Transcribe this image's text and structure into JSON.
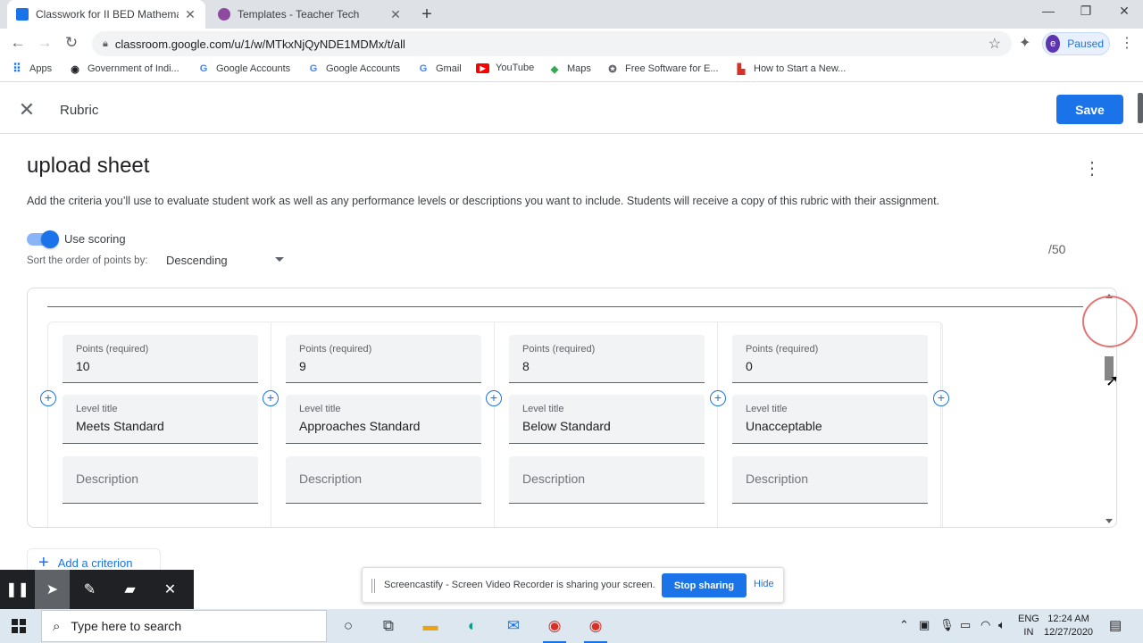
{
  "browser": {
    "tabs": [
      {
        "title": "Classwork for II BED Mathematics",
        "active": true
      },
      {
        "title": "Templates - Teacher Tech",
        "active": false
      }
    ],
    "close_glyph": "✕",
    "newtab_glyph": "+",
    "window_controls": [
      "—",
      "❐",
      "✕"
    ],
    "url": "classroom.google.com/u/1/w/MTkxNjQyNDE1MDMx/t/all",
    "profile_initial": "e",
    "profile_status": "Paused"
  },
  "bookmarks": [
    {
      "label": "Apps",
      "icon": "apps-grid-icon",
      "color": "#1a73e8"
    },
    {
      "label": "Government of Indi...",
      "icon": "emblem-icon",
      "color": "#202124"
    },
    {
      "label": "Google Accounts",
      "icon": "google-icon",
      "color": "#4285f4"
    },
    {
      "label": "Google Accounts",
      "icon": "google-icon",
      "color": "#4285f4"
    },
    {
      "label": "Gmail",
      "icon": "google-icon",
      "color": "#4285f4"
    },
    {
      "label": "YouTube",
      "icon": "youtube-icon",
      "color": "#ff0000"
    },
    {
      "label": "Maps",
      "icon": "maps-icon",
      "color": "#34a853"
    },
    {
      "label": "Free Software for E...",
      "icon": "software-icon",
      "color": "#5f6368"
    },
    {
      "label": "How to Start a New...",
      "icon": "blocks-icon",
      "color": "#d93025"
    }
  ],
  "header": {
    "title": "Rubric",
    "save_label": "Save"
  },
  "rubric": {
    "title": "upload sheet",
    "description": "Add the criteria you’ll use to evaluate student work as well as any performance levels or descriptions you want to include. Students will receive a copy of this rubric with their assignment.",
    "use_scoring_label": "Use scoring",
    "use_scoring": true,
    "sort_label": "Sort the order of points by:",
    "sort_value": "Descending",
    "total": "/50",
    "levels": [
      {
        "points_label": "Points (required)",
        "points": "10",
        "title_label": "Level title",
        "title": "Meets Standard",
        "desc_placeholder": "Description"
      },
      {
        "points_label": "Points (required)",
        "points": "9",
        "title_label": "Level title",
        "title": "Approaches Standard",
        "desc_placeholder": "Description"
      },
      {
        "points_label": "Points (required)",
        "points": "8",
        "title_label": "Level title",
        "title": "Below Standard",
        "desc_placeholder": "Description"
      },
      {
        "points_label": "Points (required)",
        "points": "0",
        "title_label": "Level title",
        "title": "Unacceptable",
        "desc_placeholder": "Description"
      }
    ],
    "add_criterion_label": "Add a criterion"
  },
  "screencastify": {
    "message": "Screencastify - Screen Video Recorder is sharing your screen.",
    "stop_label": "Stop sharing",
    "hide_label": "Hide"
  },
  "taskbar": {
    "search_placeholder": "Type here to search",
    "lang_line1": "ENG",
    "lang_line2": "IN",
    "time": "12:24 AM",
    "date": "12/27/2020"
  },
  "colors": {
    "accent": "#1a73e8"
  }
}
